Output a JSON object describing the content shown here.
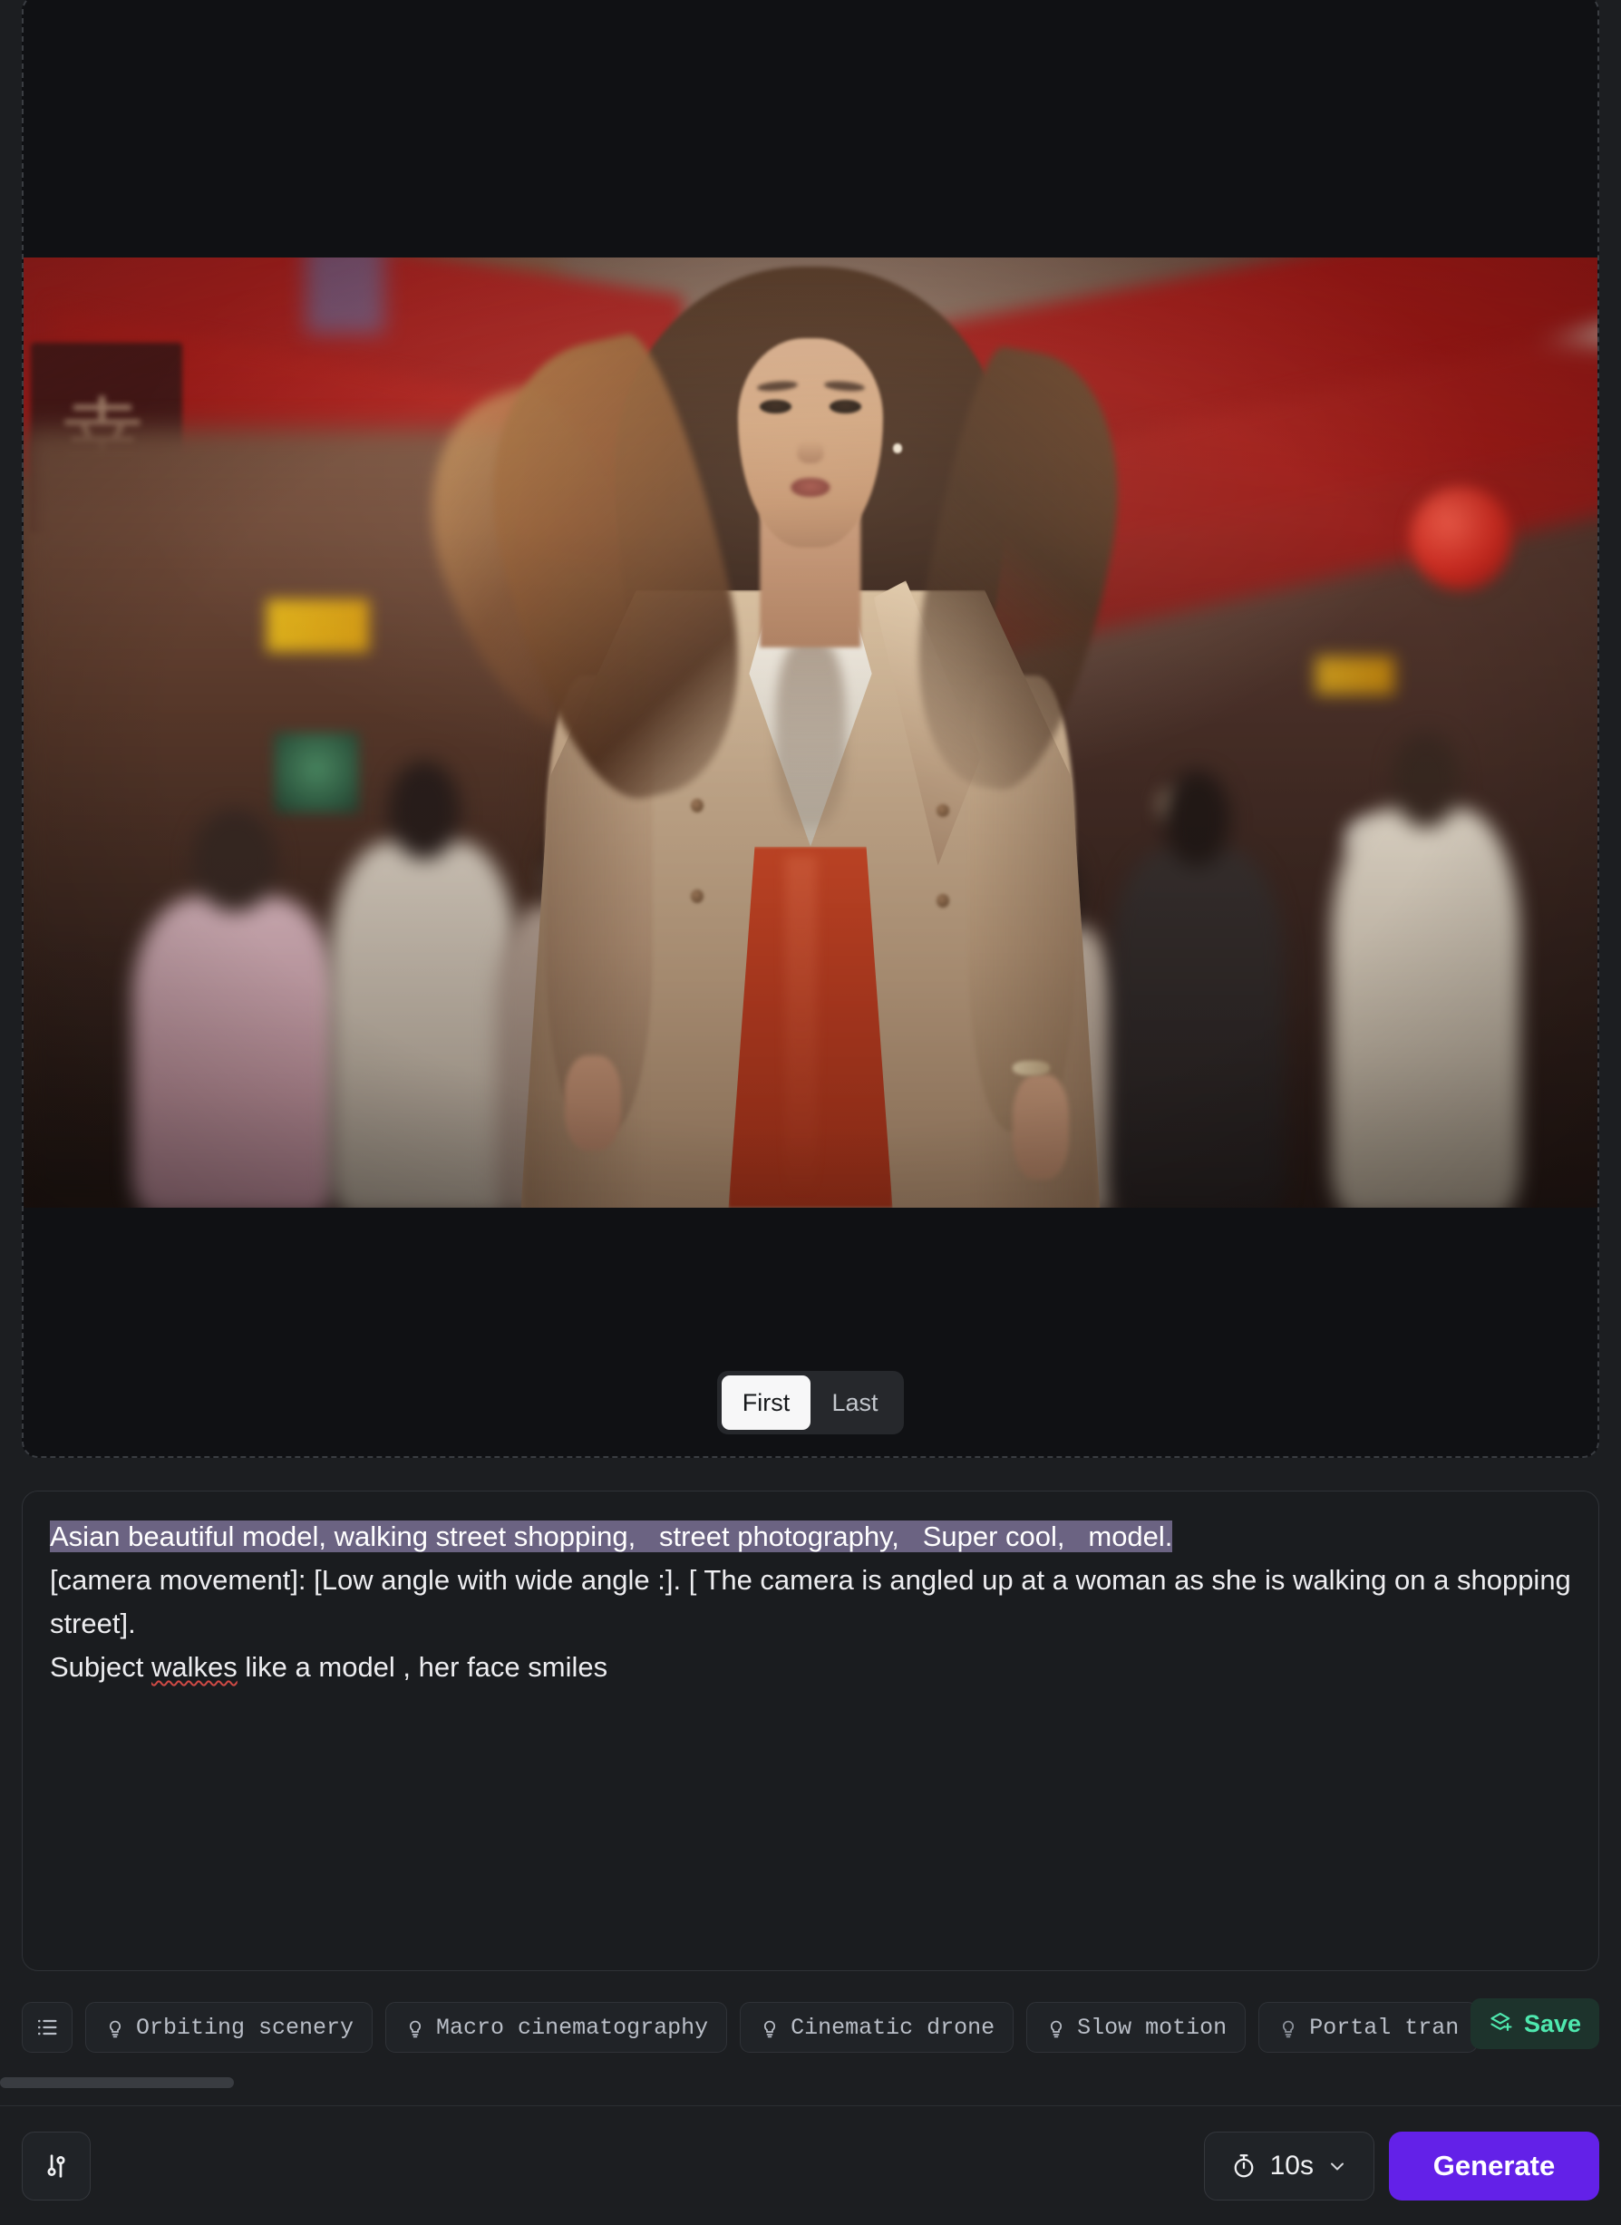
{
  "preview": {
    "frame_toggle": {
      "options": [
        "First",
        "Last"
      ],
      "selected": "First"
    },
    "image_alt": "Asian model in beige trench coat and red skirt walking down a blurred shopping street with red awnings"
  },
  "prompt": {
    "line1_selected": "Asian beautiful model, walking street shopping,   street photography,   Super cool,   model.",
    "line2_a": "[camera movement]: [Low angle with wide angle :]. [ The camera is angled up at a woman as she is walking on a shopping street].",
    "line3_a": "Subject ",
    "line3_misspelled": "walkes",
    "line3_b": " like a model , her face smiles"
  },
  "presets": {
    "list_icon": "list-icon",
    "chips": [
      {
        "icon": "lightbulb-icon",
        "label": "Orbiting scenery"
      },
      {
        "icon": "lightbulb-icon",
        "label": "Macro cinematography"
      },
      {
        "icon": "lightbulb-icon",
        "label": "Cinematic drone"
      },
      {
        "icon": "lightbulb-icon",
        "label": "Slow motion"
      },
      {
        "icon": "lightbulb-icon",
        "label": "Portal tran"
      }
    ],
    "save_label": "Save",
    "save_icon": "layers-plus-icon"
  },
  "bottom_bar": {
    "settings_icon": "sliders-icon",
    "duration": {
      "icon": "stopwatch-icon",
      "value": "10s",
      "chevron": "chevron-down-icon"
    },
    "generate_label": "Generate"
  },
  "colors": {
    "accent_purple": "#6321e8",
    "save_green": "#4ee8ae",
    "selection_purple": "#6b6382",
    "page_bg": "#1c1e21",
    "panel_bg": "#1a1c1f",
    "misspell_red": "#d04a45"
  }
}
